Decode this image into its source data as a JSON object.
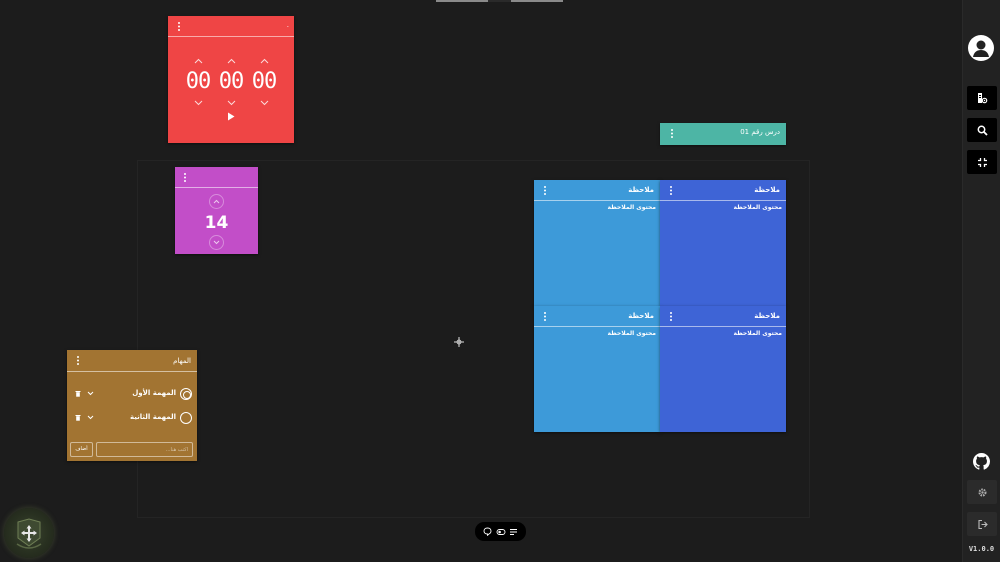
{
  "timer": {
    "hours": "00",
    "minutes": "00",
    "seconds": "00",
    "color": "#ef4545"
  },
  "counter": {
    "value": "14",
    "color": "#c24ec8"
  },
  "lesson": {
    "title": "درس رقم 01",
    "color": "#4db5a5"
  },
  "notes": [
    {
      "title": "ملاحظة",
      "body": "محتوى الملاحظة",
      "color": "#3d9ad9"
    },
    {
      "title": "ملاحظة",
      "body": "محتوى الملاحظة",
      "color": "#3e64d6"
    },
    {
      "title": "ملاحظة",
      "body": "محتوى الملاحظة",
      "color": "#3d9ad9"
    },
    {
      "title": "ملاحظة",
      "body": "محتوى الملاحظة",
      "color": "#3e64d6"
    }
  ],
  "tasks": {
    "title": "المهام",
    "items": [
      {
        "label": "المهمة الأول",
        "checked": true
      },
      {
        "label": "المهمة الثانية",
        "checked": false
      }
    ],
    "input_placeholder": "اكتب هنا...",
    "add_label": "أضاف",
    "color": "#a27432"
  },
  "sidebar": {
    "version": "V1.0.0",
    "icons": [
      "user-avatar-icon",
      "document-settings-icon",
      "search-icon",
      "collapse-icon",
      "github-icon",
      "gear-icon",
      "logout-icon"
    ]
  },
  "toolbar": {
    "icons": [
      "comment-icon",
      "toggle-icon",
      "list-icon"
    ]
  }
}
